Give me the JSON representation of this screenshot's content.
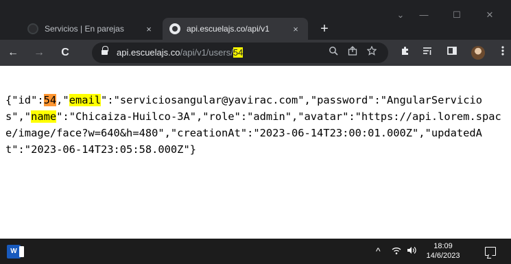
{
  "tabs": [
    {
      "title": "Servicios | En parejas",
      "close": "×"
    },
    {
      "title": "api.escuelajs.co/api/v1",
      "close": "×"
    }
  ],
  "new_tab": "+",
  "window_controls": {
    "dropdown": "⌄",
    "minimize": "—",
    "maximize": "☐",
    "close": "✕"
  },
  "toolbar": {
    "back": "←",
    "forward": "→",
    "reload": "C"
  },
  "address": {
    "host": "api.escuelajs.co",
    "path": "/api/v1/users/",
    "id": "54"
  },
  "omnibox_icons": [
    "zoom-icon",
    "share-icon",
    "star-icon"
  ],
  "json_segments": [
    {
      "t": "{\"id\":"
    },
    {
      "t": "54",
      "hl": "strong"
    },
    {
      "t": ",\""
    },
    {
      "t": "email",
      "hl": "yes"
    },
    {
      "t": "\":\"serviciosangular@yavirac.com\",\"password\":\"AngularServicios\",\""
    },
    {
      "t": "name",
      "hl": "yes"
    },
    {
      "t": "\":\"Chicaiza-Huilco-3A\",\"role\":\"admin\",\"avatar\":\"https://api.lorem.space/image/face?w=640&h=480\",\"creationAt\":\"2023-06-14T23:00:01.000Z\",\"updatedAt\":\"2023-06-14T23:05:58.000Z\"}"
    }
  ],
  "taskbar": {
    "word_label": "W",
    "tray": {
      "chevron": "^",
      "time": "18:09",
      "date": "14/6/2023"
    }
  },
  "colors": {
    "highlight": "#ffff00",
    "active_match": "#ff9632",
    "chrome_dark": "#202124",
    "toolbar": "#35363a"
  }
}
